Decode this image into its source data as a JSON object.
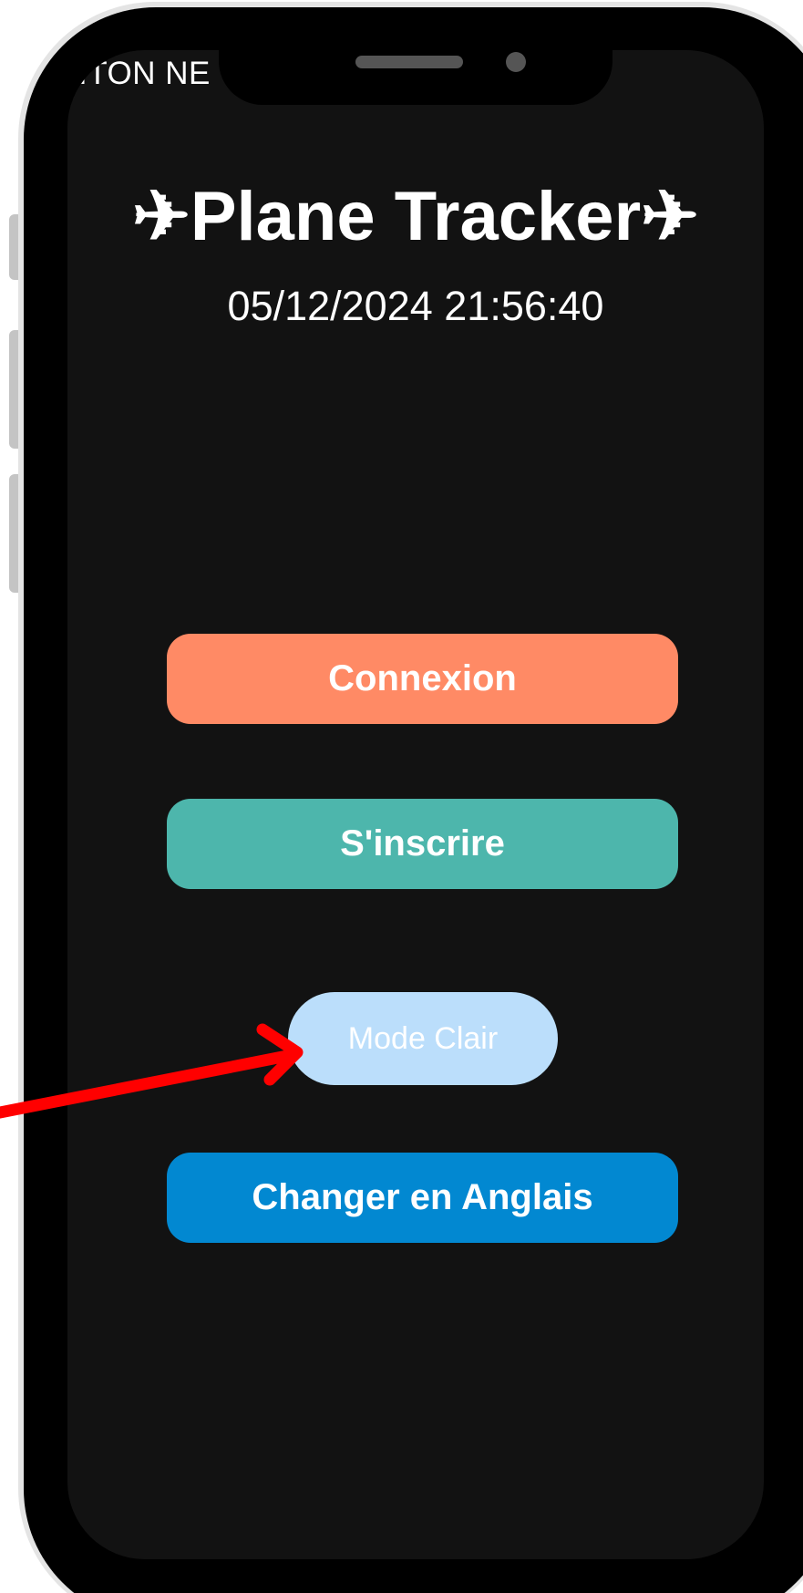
{
  "status_bar": {
    "carrier_text": "ITON NE"
  },
  "app": {
    "title": "✈Plane Tracker✈",
    "datetime": "05/12/2024 21:56:40"
  },
  "buttons": {
    "login_label": "Connexion",
    "signup_label": "S'inscrire",
    "theme_label": "Mode Clair",
    "language_label": "Changer en Anglais"
  },
  "colors": {
    "screen_background": "#121212",
    "login": "#ff8a65",
    "signup": "#4db6ac",
    "theme_toggle": "#bbdefb",
    "language": "#0288d1",
    "annotation_arrow": "#ff0000"
  },
  "annotation": {
    "arrow_target": "theme-toggle-button"
  }
}
